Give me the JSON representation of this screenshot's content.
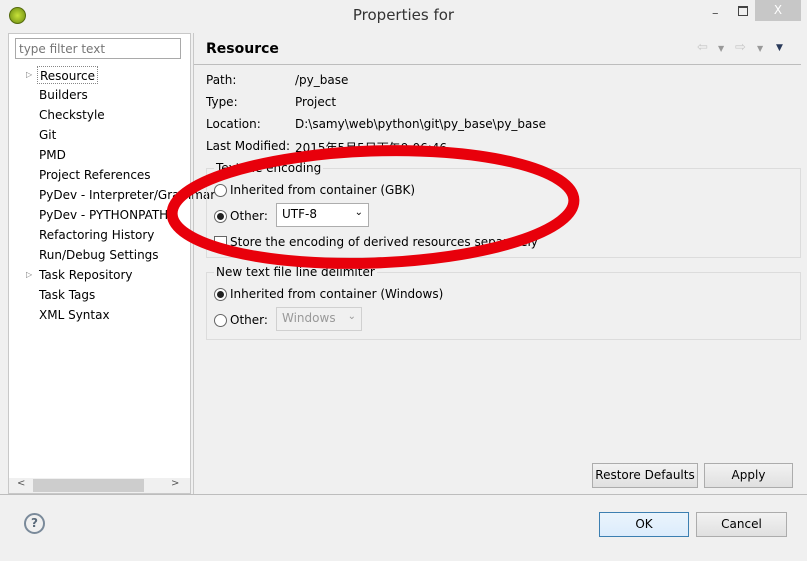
{
  "window": {
    "title": "Properties for",
    "minimize": "–",
    "close": "X"
  },
  "filter": {
    "placeholder": "type filter text"
  },
  "tree": [
    {
      "label": "Resource",
      "expandable": true,
      "selected": true
    },
    {
      "label": "Builders"
    },
    {
      "label": "Checkstyle"
    },
    {
      "label": "Git"
    },
    {
      "label": "PMD"
    },
    {
      "label": "Project References"
    },
    {
      "label": "PyDev - Interpreter/Grammar"
    },
    {
      "label": "PyDev - PYTHONPATH"
    },
    {
      "label": "Refactoring History"
    },
    {
      "label": "Run/Debug Settings"
    },
    {
      "label": "Task Repository",
      "expandable": true
    },
    {
      "label": "Task Tags"
    },
    {
      "label": "XML Syntax"
    }
  ],
  "page": {
    "title": "Resource",
    "info": [
      {
        "label": "Path:",
        "value": "/py_base"
      },
      {
        "label": "Type:",
        "value": "Project"
      },
      {
        "label": "Location:",
        "value": "D:\\samy\\web\\python\\git\\py_base\\py_base"
      },
      {
        "label": "Last Modified:",
        "value": "2015年5月5日下午9:06:46"
      }
    ],
    "encoding": {
      "title": "Text file encoding",
      "inherited": "Inherited from container (GBK)",
      "other": "Other:",
      "other_value": "UTF-8",
      "selected": "other",
      "store_separately": "Store the encoding of derived resources separately",
      "store_checked": false
    },
    "delimiter": {
      "title": "New text file line delimiter",
      "inherited": "Inherited from container (Windows)",
      "other": "Other:",
      "other_value": "Windows",
      "selected": "inherited"
    },
    "restore_defaults": "Restore Defaults",
    "apply": "Apply"
  },
  "footer": {
    "help": "?",
    "ok": "OK",
    "cancel": "Cancel"
  },
  "annotation": {
    "shape": "ellipse",
    "color": "#e8000b"
  }
}
